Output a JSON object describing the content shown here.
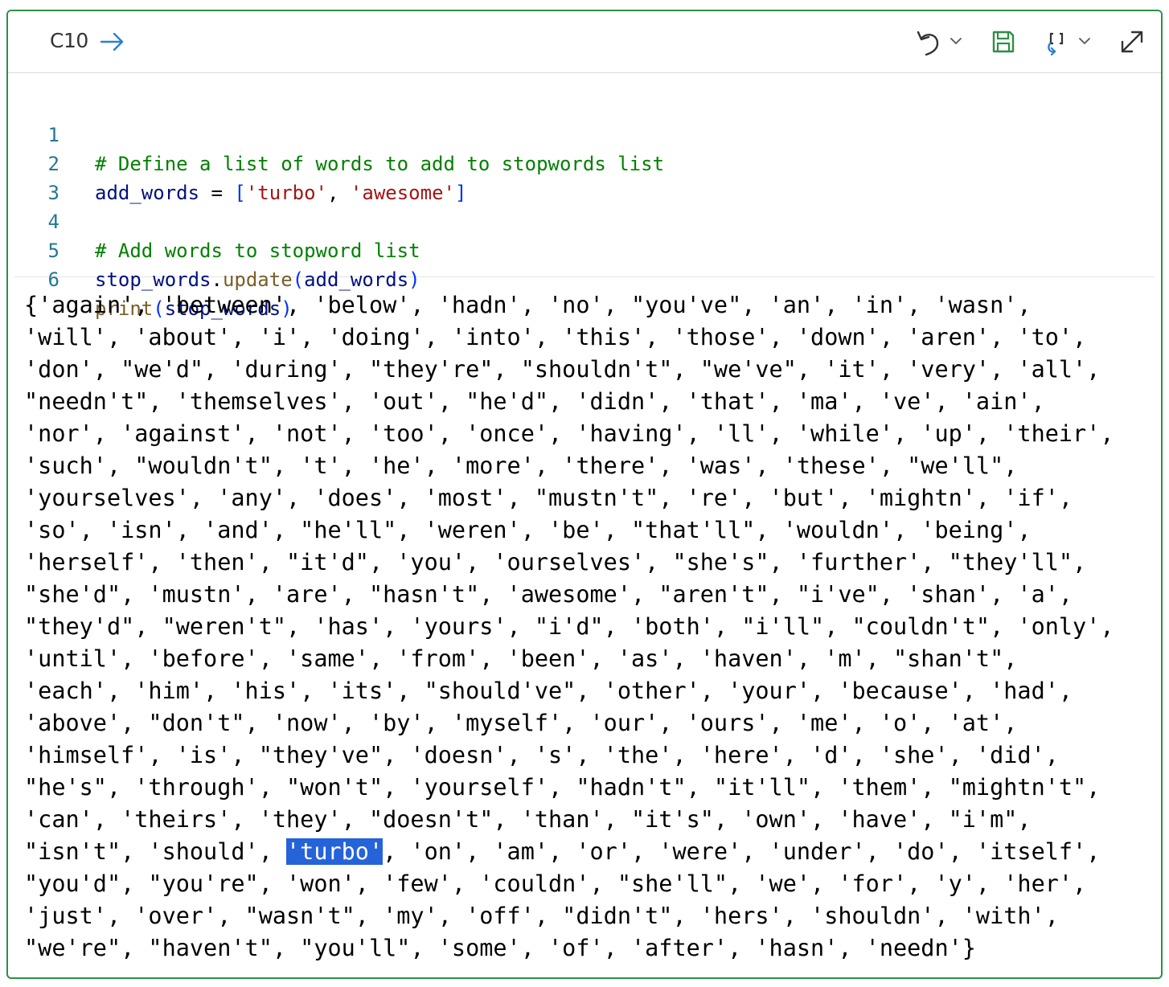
{
  "toolbar": {
    "cell_label": "C10",
    "icons": [
      "arrow-right-icon",
      "undo-icon",
      "chevron-down-icon",
      "save-icon",
      "convert-icon",
      "chevron-down-icon",
      "expand-icon"
    ]
  },
  "code": {
    "lines": [
      {
        "number": "1",
        "text": "# Define a list of words to add to stopwords list"
      },
      {
        "number": "2",
        "text": "add_words = ['turbo', 'awesome']"
      },
      {
        "number": "3",
        "text": ""
      },
      {
        "number": "4",
        "text": "# Add words to stopword list"
      },
      {
        "number": "5",
        "text": "stop_words.update(add_words)"
      },
      {
        "number": "6",
        "text": "print(stop_words)"
      }
    ]
  },
  "output": {
    "lines": [
      "{'again', 'between', 'below', 'hadn', 'no', \"you've\", 'an', 'in', 'wasn',",
      "'will', 'about', 'i', 'doing', 'into', 'this', 'those', 'down', 'aren', 'to',",
      "'don', \"we'd\", 'during', \"they're\", \"shouldn't\", \"we've\", 'it', 'very', 'all',",
      "\"needn't\", 'themselves', 'out', \"he'd\", 'didn', 'that', 'ma', 've', 'ain',",
      "'nor', 'against', 'not', 'too', 'once', 'having', 'll', 'while', 'up', 'their',",
      "'such', \"wouldn't\", 't', 'he', 'more', 'there', 'was', 'these', \"we'll\",",
      "'yourselves', 'any', 'does', 'most', \"mustn't\", 're', 'but', 'mightn', 'if',",
      "'so', 'isn', 'and', \"he'll\", 'weren', 'be', \"that'll\", 'wouldn', 'being',",
      "'herself', 'then', \"it'd\", 'you', 'ourselves', \"she's\", 'further', \"they'll\",",
      "\"she'd\", 'mustn', 'are', \"hasn't\", 'awesome', \"aren't\", \"i've\", 'shan', 'a',",
      "\"they'd\", \"weren't\", 'has', 'yours', \"i'd\", 'both', \"i'll\", \"couldn't\", 'only',",
      "'until', 'before', 'same', 'from', 'been', 'as', 'haven', 'm', \"shan't\",",
      "'each', 'him', 'his', 'its', \"should've\", 'other', 'your', 'because', 'had',",
      "'above', \"don't\", 'now', 'by', 'myself', 'our', 'ours', 'me', 'o', 'at',",
      "'himself', 'is', \"they've\", 'doesn', 's', 'the', 'here', 'd', 'she', 'did',",
      "\"he's\", 'through', \"won't\", 'yourself', \"hadn't\", \"it'll\", 'them', \"mightn't\",",
      "'can', 'theirs', 'they', \"doesn't\", 'than', \"it's\", 'own', 'have', \"i'm\",",
      "\"isn't\", 'should', 'turbo', 'on', 'am', 'or', 'were', 'under', 'do', 'itself',",
      "\"you'd\", \"you're\", 'won', 'few', 'couldn', \"she'll\", 'we', 'for', 'y', 'her',",
      "'just', 'over', \"wasn't\", 'my', 'off', \"didn't\", 'hers', 'shouldn', 'with',",
      "\"we're\", \"haven't\", \"you'll\", 'some', 'of', 'after', 'hasn', 'needn'}"
    ],
    "highlight": {
      "line": 17,
      "text": "'turbo'"
    }
  },
  "colors": {
    "cell_border": "#2f8f46",
    "save_icon": "#2f8f46",
    "run_arrow": "#2a7fd4",
    "highlight_bg": "#2563d9",
    "comment": "#008000",
    "string": "#a31515",
    "variable": "#001080",
    "function": "#795e26",
    "bracket": "#0431fa",
    "line_number": "#237893"
  }
}
